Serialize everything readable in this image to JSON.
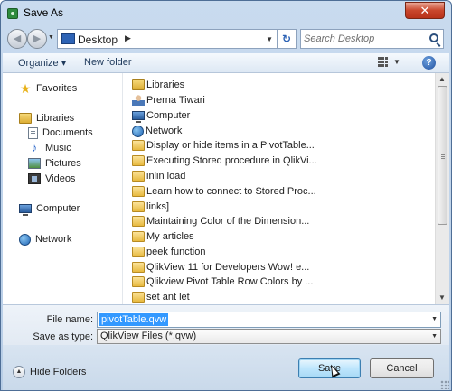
{
  "window": {
    "title": "Save As",
    "close_label": "✕"
  },
  "address": {
    "location": "Desktop",
    "search_placeholder": "Search Desktop"
  },
  "toolbar": {
    "organize_label": "Organize ▾",
    "new_folder_label": "New folder",
    "help_label": "?"
  },
  "navpane": {
    "items": [
      {
        "label": "Favorites",
        "icon": "star-icon"
      },
      {
        "label": "Libraries",
        "icon": "library-icon"
      },
      {
        "label": "Documents",
        "icon": "documents-icon"
      },
      {
        "label": "Music",
        "icon": "music-icon"
      },
      {
        "label": "Pictures",
        "icon": "pictures-icon"
      },
      {
        "label": "Videos",
        "icon": "videos-icon"
      },
      {
        "label": "Computer",
        "icon": "computer-icon"
      },
      {
        "label": "Network",
        "icon": "network-icon"
      }
    ]
  },
  "files": [
    {
      "name": "Libraries",
      "icon": "library-icon"
    },
    {
      "name": "Prerna Tiwari",
      "icon": "user-folder-icon"
    },
    {
      "name": "Computer",
      "icon": "computer-icon"
    },
    {
      "name": "Network",
      "icon": "network-icon"
    },
    {
      "name": "Display or hide items in a PivotTable...",
      "icon": "folder-icon"
    },
    {
      "name": "Executing Stored procedure in QlikVi...",
      "icon": "folder-icon"
    },
    {
      "name": "inlin load",
      "icon": "folder-icon"
    },
    {
      "name": "Learn how to connect to Stored Proc...",
      "icon": "folder-icon"
    },
    {
      "name": "links]",
      "icon": "folder-icon"
    },
    {
      "name": "Maintaining Color of the Dimension...",
      "icon": "folder-icon"
    },
    {
      "name": "My articles",
      "icon": "folder-icon"
    },
    {
      "name": "peek function",
      "icon": "folder-icon"
    },
    {
      "name": "QlikView 11 for Developers  Wow! e...",
      "icon": "folder-icon"
    },
    {
      "name": "Qlikview Pivot Table Row Colors by ...",
      "icon": "folder-icon"
    },
    {
      "name": "set ant let",
      "icon": "folder-icon"
    }
  ],
  "form": {
    "file_name_label": "File name:",
    "file_name_value": "pivotTable.qvw",
    "save_as_type_label": "Save as type:",
    "save_as_type_value": "QlikView Files (*.qvw)"
  },
  "footer": {
    "hide_folders_label": "Hide Folders",
    "save_label": "Save",
    "cancel_label": "Cancel"
  }
}
